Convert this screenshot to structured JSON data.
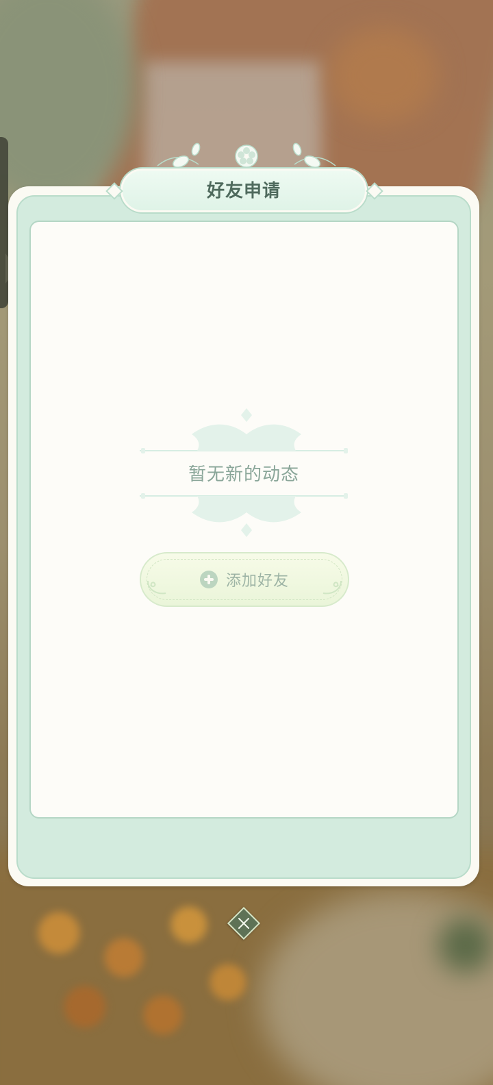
{
  "dialog": {
    "title": "好友申请",
    "empty_message": "暂无新的动态",
    "add_friend_label": "添加好友",
    "add_friend_icon": "plus-circle-icon",
    "close_icon": "close-x-icon"
  },
  "colors": {
    "panel_frame": "#fbfaf3",
    "panel_mint": "#d3ebde",
    "card_bg": "#fdfcf8",
    "title_text": "#4f6a5d",
    "empty_text": "#8aa699",
    "button_bg": "#eaf5d9",
    "close_button": "#5e7256"
  }
}
